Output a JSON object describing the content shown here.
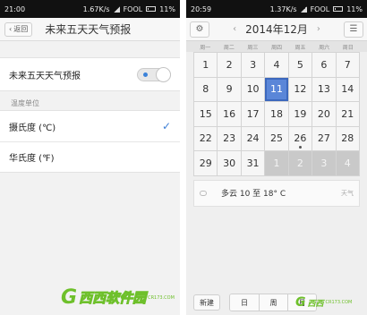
{
  "left": {
    "status": {
      "time": "21:00",
      "speed": "1.67K/s",
      "carrier": "FOOL",
      "battery": "11%"
    },
    "header": {
      "back_label": "返回",
      "title": "未来五天天气预报"
    },
    "forecast_toggle": {
      "label": "未来五天天气预报",
      "on": true
    },
    "unit_section": {
      "label": "温度单位",
      "options": [
        {
          "label": "摄氏度 (℃)",
          "selected": true
        },
        {
          "label": "华氏度 (℉)",
          "selected": false
        }
      ]
    }
  },
  "right": {
    "status": {
      "time": "20:59",
      "speed": "1.37K/s",
      "carrier": "FOOL",
      "battery": "11%"
    },
    "header": {
      "month_title": "2014年12月",
      "prev": "‹",
      "next": "›"
    },
    "weekdays": [
      "周一",
      "周二",
      "周三",
      "周四",
      "周五",
      "周六",
      "周日"
    ],
    "days": [
      {
        "d": "1"
      },
      {
        "d": "2"
      },
      {
        "d": "3"
      },
      {
        "d": "4"
      },
      {
        "d": "5"
      },
      {
        "d": "6"
      },
      {
        "d": "7"
      },
      {
        "d": "8"
      },
      {
        "d": "9"
      },
      {
        "d": "10"
      },
      {
        "d": "11",
        "selected": true
      },
      {
        "d": "12"
      },
      {
        "d": "13"
      },
      {
        "d": "14"
      },
      {
        "d": "15"
      },
      {
        "d": "16"
      },
      {
        "d": "17"
      },
      {
        "d": "18"
      },
      {
        "d": "19"
      },
      {
        "d": "20"
      },
      {
        "d": "21"
      },
      {
        "d": "22"
      },
      {
        "d": "23"
      },
      {
        "d": "24"
      },
      {
        "d": "25"
      },
      {
        "d": "26",
        "mark": true
      },
      {
        "d": "27"
      },
      {
        "d": "28"
      },
      {
        "d": "29"
      },
      {
        "d": "30"
      },
      {
        "d": "31"
      },
      {
        "d": "1",
        "other": true
      },
      {
        "d": "2",
        "other": true
      },
      {
        "d": "3",
        "other": true
      },
      {
        "d": "4",
        "other": true
      }
    ],
    "weather": {
      "text": "多云  10 至 18° C",
      "tag": "天气"
    },
    "bottom": {
      "new_label": "新建",
      "views": [
        "日",
        "周",
        "月"
      ]
    }
  },
  "watermarks": [
    {
      "glyph": "G",
      "title": "西西软件园",
      "sub": "CR173.COM"
    },
    {
      "glyph": "G",
      "title": "西西",
      "sub": "CR173.COM"
    }
  ]
}
